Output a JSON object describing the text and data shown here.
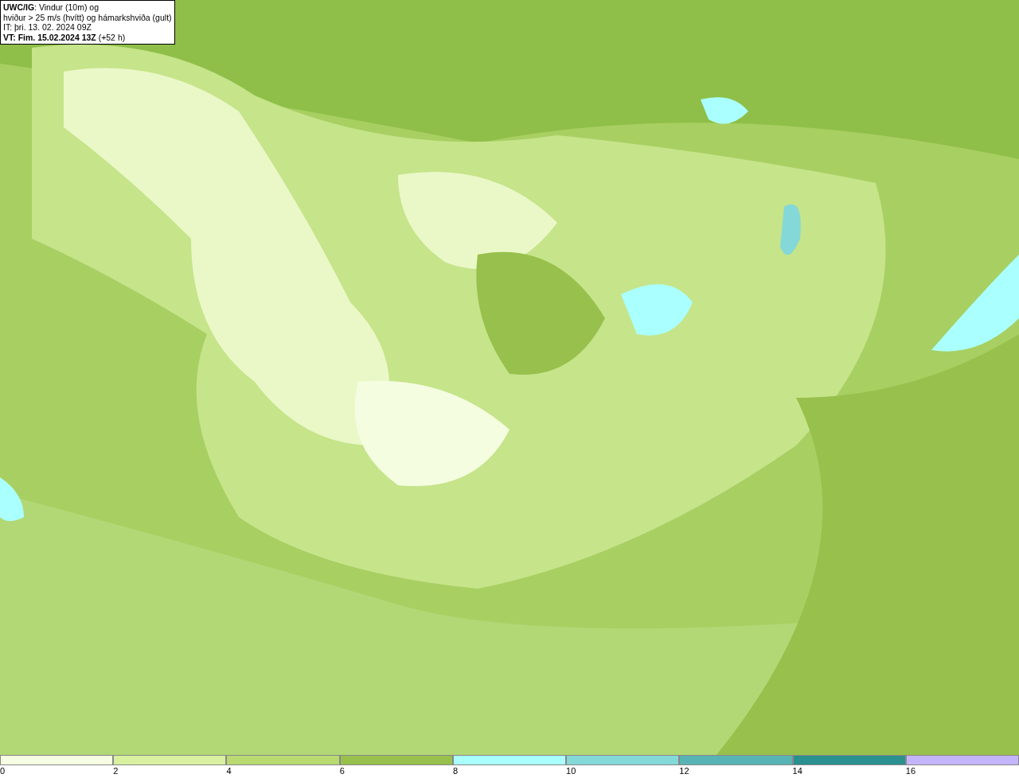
{
  "title_box": {
    "lines": [
      "**UWC/IG**: Vindur (10m) og",
      "hviður > 25 m/s (hvítt) og hámarkshviða (gult)",
      "IT: þri. 13. 02. 2024 09Z",
      "**VT: Fim. 15.02.2024 13Z** (+52 h)"
    ]
  },
  "legend": {
    "bins": [
      {
        "color": "#f6fde2",
        "label": "0"
      },
      {
        "color": "#d8f0a0",
        "label": "2"
      },
      {
        "color": "#b8da70",
        "label": "4"
      },
      {
        "color": "#98c04c",
        "label": "6"
      },
      {
        "color": "#aaffff",
        "label": "8"
      },
      {
        "color": "#84d8d8",
        "label": "10"
      },
      {
        "color": "#58b4b4",
        "label": "12"
      },
      {
        "color": "#2a9090",
        "label": "14"
      },
      {
        "color": "#c4b4fa",
        "label": "16"
      }
    ]
  }
}
